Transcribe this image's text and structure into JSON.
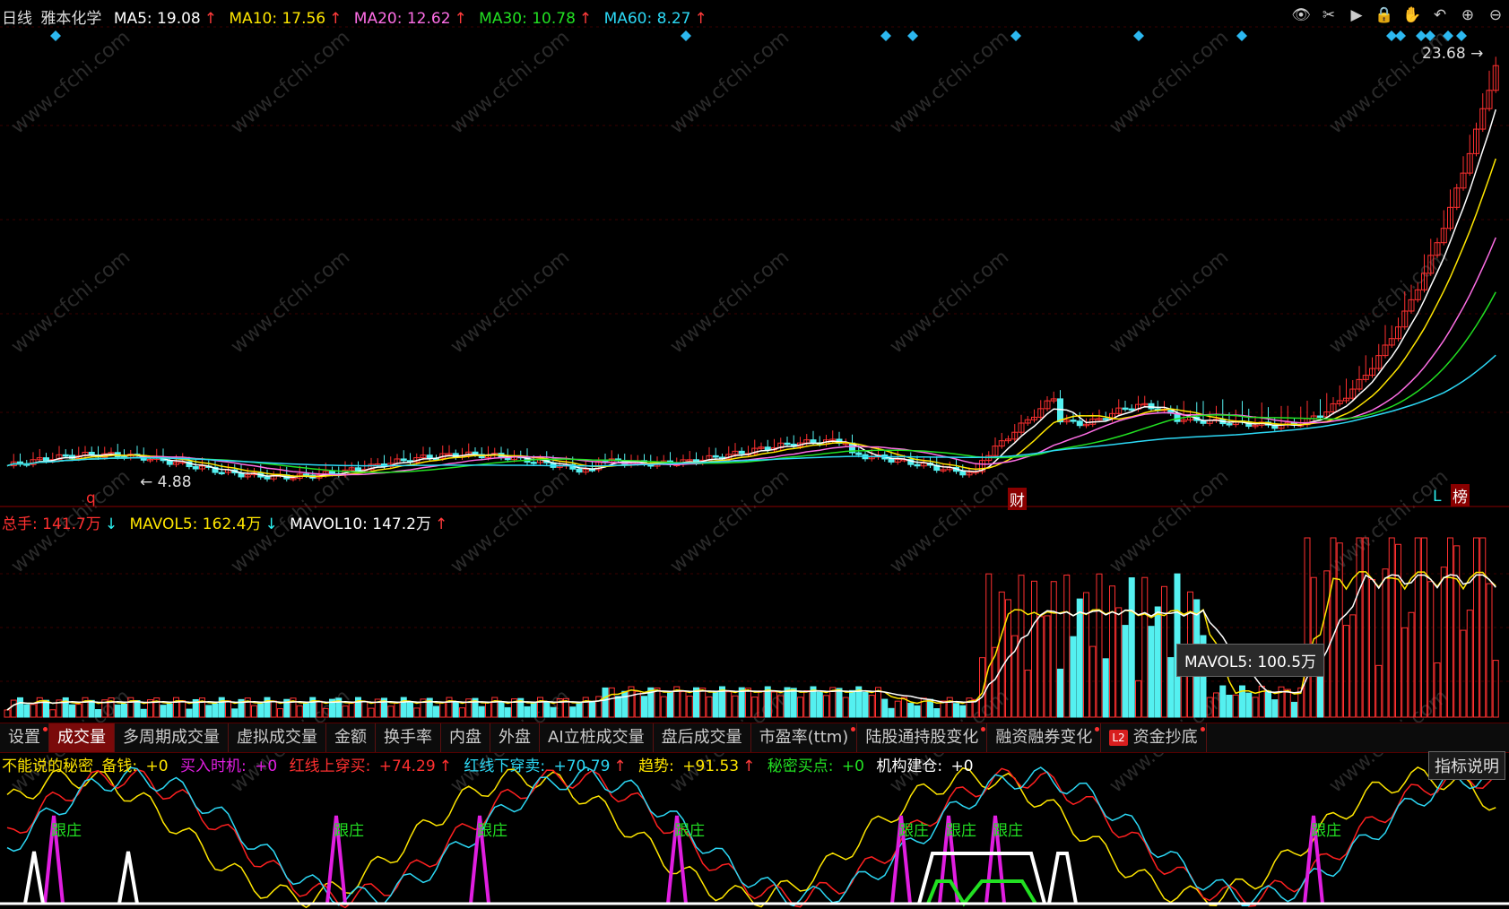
{
  "main": {
    "period": "日线",
    "stock": "雅本化学",
    "ma": [
      {
        "label": "MA5: 19.08",
        "arrow": "↑",
        "color": "#ffffff"
      },
      {
        "label": "MA10: 17.56",
        "arrow": "↑",
        "color": "#ffe600"
      },
      {
        "label": "MA20: 12.62",
        "arrow": "↑",
        "color": "#ff6ee6"
      },
      {
        "label": "MA30: 10.78",
        "arrow": "↑",
        "color": "#22e022"
      },
      {
        "label": "MA60: 8.27",
        "arrow": "↑",
        "color": "#2cd8f5"
      }
    ],
    "high_label": "23.68",
    "low_label": "4.88",
    "marks": {
      "q": "q",
      "cai": "财",
      "L": "L",
      "bang": "榜"
    }
  },
  "toolbar_icons": [
    "eye-icon",
    "scissors-icon",
    "play-circle-icon",
    "lock-icon",
    "hand-icon",
    "undo-icon",
    "zoom-in-icon",
    "zoom-out-icon"
  ],
  "volume": {
    "total_label": "总手: 141.7万",
    "total_arrow": "↓",
    "mavol5_label": "MAVOL5: 162.4万",
    "mavol5_arrow": "↓",
    "mavol10_label": "MAVOL10: 147.2万",
    "mavol10_arrow": "↑",
    "tooltip": "MAVOL5: 100.5万"
  },
  "tabs": [
    "设置",
    "成交量",
    "多周期成交量",
    "虚拟成交量",
    "金额",
    "换手率",
    "内盘",
    "外盘",
    "AI立桩成交量",
    "盘后成交量",
    "市盈率(ttm)",
    "陆股通持股变化",
    "融资融券变化",
    "资金抄底"
  ],
  "tab_l2": "L2",
  "indicator": {
    "name": "不能说的秘密",
    "items": [
      {
        "label": "备钱:",
        "value": "+0",
        "arrow": "",
        "color": "#ffe600"
      },
      {
        "label": "买入时机:",
        "value": "+0",
        "arrow": "",
        "color": "#e01ee0"
      },
      {
        "label": "红线上穿买:",
        "value": "+74.29",
        "arrow": "↑",
        "color": "#ff3030"
      },
      {
        "label": "红线下穿卖:",
        "value": "+70.79",
        "arrow": "↑",
        "color": "#2cd8f5"
      },
      {
        "label": "趋势:",
        "value": "+91.53",
        "arrow": "↑",
        "color": "#ffe600"
      },
      {
        "label": "秘密买点:",
        "value": "+0",
        "arrow": "",
        "color": "#22e022"
      },
      {
        "label": "机构建仓:",
        "value": "+0",
        "arrow": "",
        "color": "#ffffff"
      }
    ],
    "explain_button": "指标说明",
    "signal": "跟庄"
  },
  "watermark": "www.cfchi.com",
  "colors": {
    "up": "#ff3030",
    "down": "#54f0f0",
    "grid": "#3a0000"
  }
}
